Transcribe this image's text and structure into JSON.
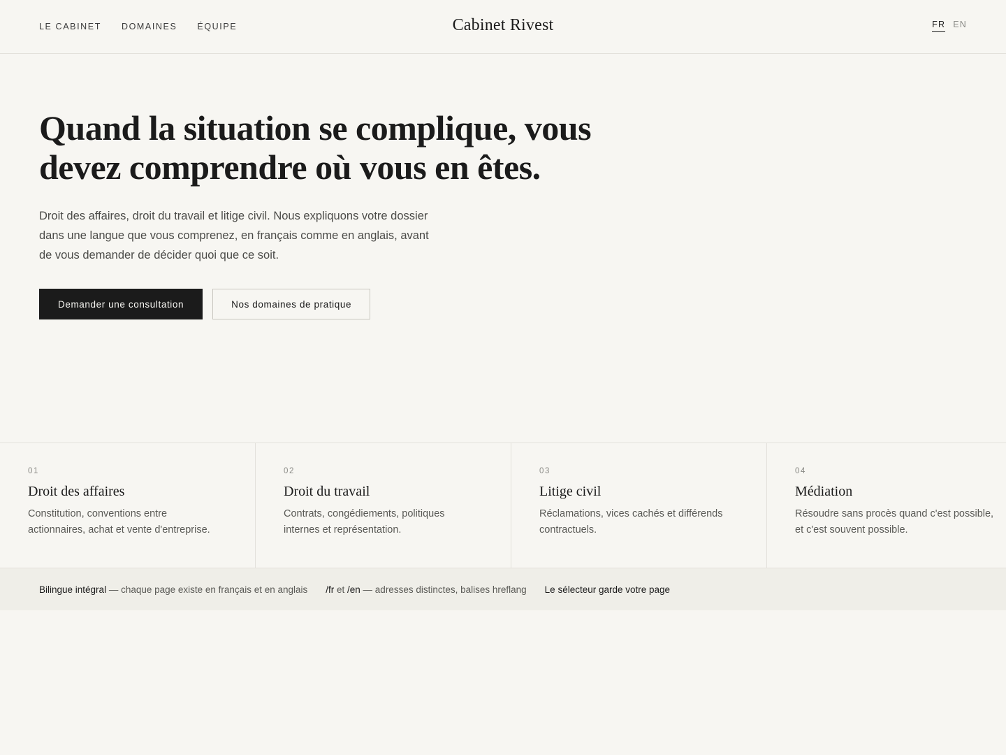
{
  "header": {
    "nav": [
      "LE CABINET",
      "DOMAINES",
      "ÉQUIPE"
    ],
    "brand": "Cabinet Rivest",
    "languages": [
      "FR",
      "EN"
    ],
    "active_language": "FR"
  },
  "hero": {
    "title": "Quand la situation se complique, vous devez comprendre où vous en êtes.",
    "lead": "Droit des affaires, droit du travail et litige civil. Nous expliquons votre dossier dans une langue que vous comprenez, en français comme en anglais, avant de vous demander de décider quoi que ce soit.",
    "primary_cta": "Demander une consultation",
    "secondary_cta": "Nos domaines de pratique"
  },
  "practices": [
    {
      "number": "01",
      "title": "Droit des affaires",
      "desc": "Constitution, conventions entre actionnaires, achat et vente d'entreprise."
    },
    {
      "number": "02",
      "title": "Droit du travail",
      "desc": "Contrats, congédiements, politiques internes et représentation."
    },
    {
      "number": "03",
      "title": "Litige civil",
      "desc": "Réclamations, vices cachés et différends contractuels."
    },
    {
      "number": "04",
      "title": "Médiation",
      "desc": "Résoudre sans procès quand c'est possible, et c'est souvent possible."
    }
  ],
  "info_strip": {
    "item1_strong": "Bilingue intégral",
    "item1_rest": " — chaque page existe en français et en anglais",
    "item2_fr": "/fr",
    "item2_and": " et ",
    "item2_en": "/en",
    "item2_rest": " — adresses distinctes, balises hreflang",
    "item3": "Le sélecteur garde votre page"
  },
  "colors": {
    "background": "#f7f6f2",
    "text": "#1b1b1b",
    "strip": "#efeee8",
    "border": "#e3e1db"
  }
}
